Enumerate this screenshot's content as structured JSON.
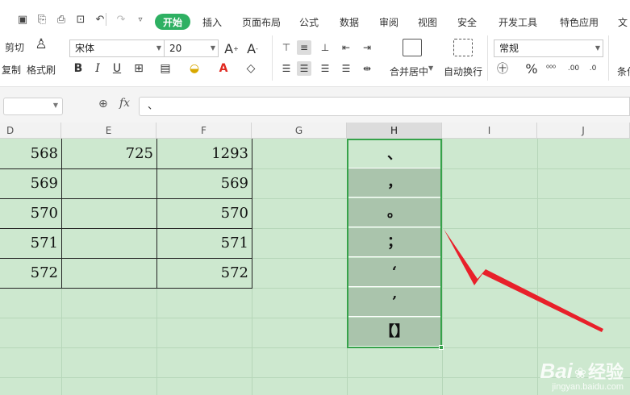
{
  "menu": {
    "tabs": [
      "开始",
      "插入",
      "页面布局",
      "公式",
      "数据",
      "审阅",
      "视图",
      "安全",
      "开发工具",
      "特色应用",
      "文"
    ]
  },
  "ribbon": {
    "cut_label": "剪切",
    "copy_label": "复制",
    "format_painter_label": "格式刷",
    "font_name": "宋体",
    "font_size": "20",
    "merge_center_label": "合并居中",
    "wrap_text_label": "自动换行",
    "number_format": "常规",
    "cond_format_label": "条件"
  },
  "formula_bar": {
    "fx_label": "fx",
    "value": "、"
  },
  "columns": [
    "D",
    "E",
    "F",
    "G",
    "H",
    "I",
    "J"
  ],
  "active_column": "H",
  "rows": [
    {
      "d": "568",
      "e": "725",
      "f": "1293"
    },
    {
      "d": "569",
      "e": "",
      "f": "569"
    },
    {
      "d": "570",
      "e": "",
      "f": "570"
    },
    {
      "d": "571",
      "e": "",
      "f": "571"
    },
    {
      "d": "572",
      "e": "",
      "f": "572"
    }
  ],
  "h_cells": [
    "、",
    "，",
    "。",
    "；",
    "‘",
    "’",
    "【】"
  ],
  "watermark": {
    "brand": "Bai",
    "brand_cn": "经验",
    "url": "jingyan.baidu.com"
  },
  "colors": {
    "accent": "#2eb062",
    "sheet_fill": "#cde8cf",
    "selection_border": "#36a24a",
    "selected_fill": "#aac4ac",
    "arrow": "#e8202a"
  }
}
